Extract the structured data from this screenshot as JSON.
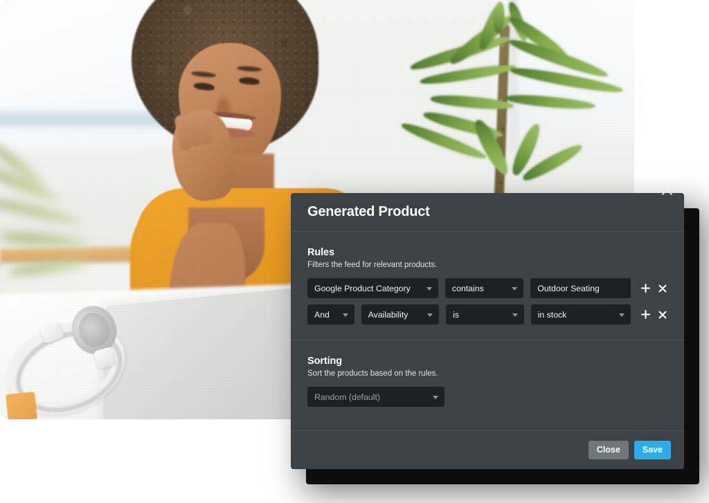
{
  "photo": {
    "alt": "Smiling woman with curly hair sitting at a white desk in front of an open laptop, headphones beside her, potted plant and bright windows behind"
  },
  "modal": {
    "title": "Generated Product",
    "close_icon": "close-icon",
    "sections": {
      "rules": {
        "heading": "Rules",
        "description": "Filters the feed for relevant products.",
        "rows": [
          {
            "conjunction": null,
            "field": "Google Product Category",
            "operator": "contains",
            "value": "Outdoor Seating",
            "value_is_select": false,
            "add_icon": "plus-icon",
            "remove_icon": "close-x-icon"
          },
          {
            "conjunction": "And",
            "field": "Availability",
            "operator": "is",
            "value": "in stock",
            "value_is_select": true,
            "add_icon": "plus-icon",
            "remove_icon": "close-x-icon"
          }
        ]
      },
      "sorting": {
        "heading": "Sorting",
        "description": "Sort the products based on the rules.",
        "select_value": "Random (default)"
      }
    },
    "footer": {
      "close_label": "Close",
      "save_label": "Save"
    }
  },
  "colors": {
    "modal_bg": "#3c4246",
    "field_bg": "#1d2125",
    "divider": "#4c5256",
    "save_blue": "#2badeb",
    "close_gray": "#6f777b",
    "text": "#ffffff",
    "placeholder": "#9aa1a5"
  }
}
